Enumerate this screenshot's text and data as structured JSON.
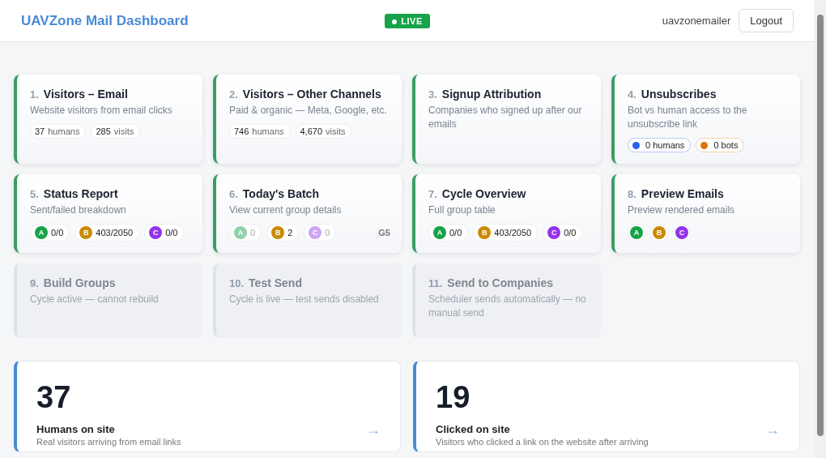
{
  "header": {
    "title": "UAVZone Mail Dashboard",
    "status": "LIVE",
    "user": "uavzonemailer",
    "logout": "Logout"
  },
  "cards": [
    {
      "number": "1.",
      "title": "Visitors – Email",
      "subtitle": "Website visitors from email clicks",
      "disabled": false,
      "chips": [
        {
          "kind": "stat",
          "value": "37",
          "unit": "humans"
        },
        {
          "kind": "stat",
          "value": "285",
          "unit": "visits"
        }
      ]
    },
    {
      "number": "2.",
      "title": "Visitors – Other Channels",
      "subtitle": "Paid & organic — Meta, Google, etc.",
      "disabled": false,
      "chips": [
        {
          "kind": "stat",
          "value": "746",
          "unit": "humans"
        },
        {
          "kind": "stat",
          "value": "4,670",
          "unit": "visits"
        }
      ]
    },
    {
      "number": "3.",
      "title": "Signup Attribution",
      "subtitle": "Companies who signed up after our emails",
      "disabled": false
    },
    {
      "number": "4.",
      "title": "Unsubscribes",
      "subtitle": "Bot vs human access to the unsubscribe link",
      "disabled": false,
      "chips": [
        {
          "kind": "dot",
          "color": "#2563eb",
          "label": "0 humans"
        },
        {
          "kind": "dot",
          "color": "#d97706",
          "label": "0 bots"
        }
      ]
    },
    {
      "number": "5.",
      "title": "Status Report",
      "subtitle": "Sent/failed breakdown",
      "disabled": false,
      "chips": [
        {
          "kind": "group",
          "letter": "A",
          "color": "#16a34a",
          "value": "0/0"
        },
        {
          "kind": "group",
          "letter": "B",
          "color": "#ca8a04",
          "value": "403/2050"
        },
        {
          "kind": "group",
          "letter": "C",
          "color": "#9333ea",
          "value": "0/0"
        }
      ]
    },
    {
      "number": "6.",
      "title": "Today's Batch",
      "subtitle": "View current group details",
      "disabled": false,
      "tag": "G5",
      "chips": [
        {
          "kind": "group",
          "letter": "A",
          "color": "#8fd3a8",
          "value": "0",
          "dimmed": true
        },
        {
          "kind": "group",
          "letter": "B",
          "color": "#ca8a04",
          "value": "2"
        },
        {
          "kind": "group",
          "letter": "C",
          "color": "#cda4f3",
          "value": "0",
          "dimmed": true
        }
      ]
    },
    {
      "number": "7.",
      "title": "Cycle Overview",
      "subtitle": "Full group table",
      "disabled": false,
      "chips": [
        {
          "kind": "group",
          "letter": "A",
          "color": "#16a34a",
          "value": "0/0"
        },
        {
          "kind": "group",
          "letter": "B",
          "color": "#ca8a04",
          "value": "403/2050"
        },
        {
          "kind": "group",
          "letter": "C",
          "color": "#9333ea",
          "value": "0/0"
        }
      ]
    },
    {
      "number": "8.",
      "title": "Preview Emails",
      "subtitle": "Preview rendered emails",
      "disabled": false,
      "chips": [
        {
          "kind": "group",
          "letter": "A",
          "color": "#16a34a"
        },
        {
          "kind": "group",
          "letter": "B",
          "color": "#ca8a04"
        },
        {
          "kind": "group",
          "letter": "C",
          "color": "#9333ea"
        }
      ]
    },
    {
      "number": "9.",
      "title": "Build Groups",
      "subtitle": "Cycle active — cannot rebuild",
      "disabled": true
    },
    {
      "number": "10.",
      "title": "Test Send",
      "subtitle": "Cycle is live — test sends disabled",
      "disabled": true
    },
    {
      "number": "11.",
      "title": "Send to Companies",
      "subtitle": "Scheduler sends automatically — no manual send",
      "disabled": true
    }
  ],
  "stats": [
    {
      "value": "37",
      "label": "Humans on site",
      "description": "Real visitors arriving from email links",
      "arrow": "→"
    },
    {
      "value": "19",
      "label": "Clicked on site",
      "description": "Visitors who clicked a link on the website after arriving",
      "arrow": "→"
    }
  ]
}
